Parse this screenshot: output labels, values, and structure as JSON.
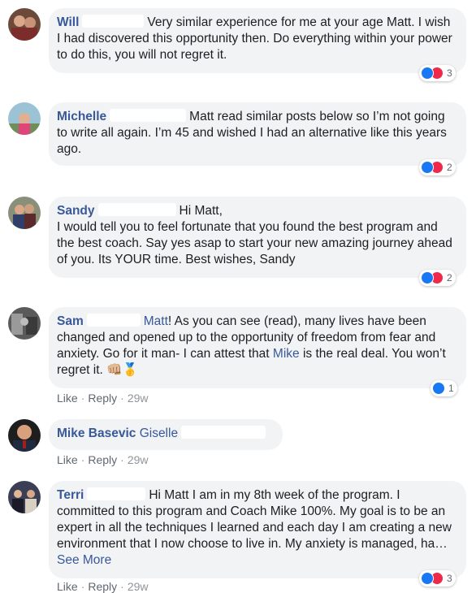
{
  "comments": [
    {
      "author": "Will",
      "text": "Very similar experience for me at your age Matt. I wish I had discovered this opportunity then. Do everything within your power to do this, you will not regret it.",
      "reaction_count": "3"
    },
    {
      "author": "Michelle",
      "text": "Matt read similar posts below so I’m not going to write all again. I’m 45 and wished I had an alternative like this years ago.",
      "reaction_count": "2"
    },
    {
      "author": "Sandy",
      "greeting": "Hi Matt,",
      "text": "I would tell you to feel fortunate that you found the best program and the best coach. Say yes asap to start your new amazing journey ahead of you. Its YOUR time. Best wishes, Sandy",
      "reaction_count": "2"
    },
    {
      "author": "Sam",
      "mention": "Matt",
      "text_part1": "! As you can see (read), many lives have been changed and opened up to the opportunity of freedom from fear and anxiety. Go for it man- I can attest that ",
      "mention2": "Mike",
      "text_part2": " is the real deal. You won’t regret it. 👊🏼🥇",
      "reaction_count": "1",
      "actions": {
        "like": "Like",
        "reply": "Reply",
        "time": "29w"
      }
    },
    {
      "author": "Mike Basevic",
      "mention": "Giselle",
      "actions": {
        "like": "Like",
        "reply": "Reply",
        "time": "29w"
      }
    },
    {
      "author": "Terri",
      "text": "Hi Matt I am in my 8th week of the program. I committed to this program and Coach Mike 100%. My goal is to be an expert in all the techniques I learned and each day I am creating a new environment that I now choose to live in. My anxiety is managed, ha…",
      "see_more": "See More",
      "reaction_count": "3",
      "actions": {
        "like": "Like",
        "reply": "Reply",
        "time": "29w"
      }
    }
  ],
  "colors": {
    "link": "#385898",
    "bubble": "#f2f3f5",
    "like": "#1877f2",
    "love": "#f0284a"
  }
}
